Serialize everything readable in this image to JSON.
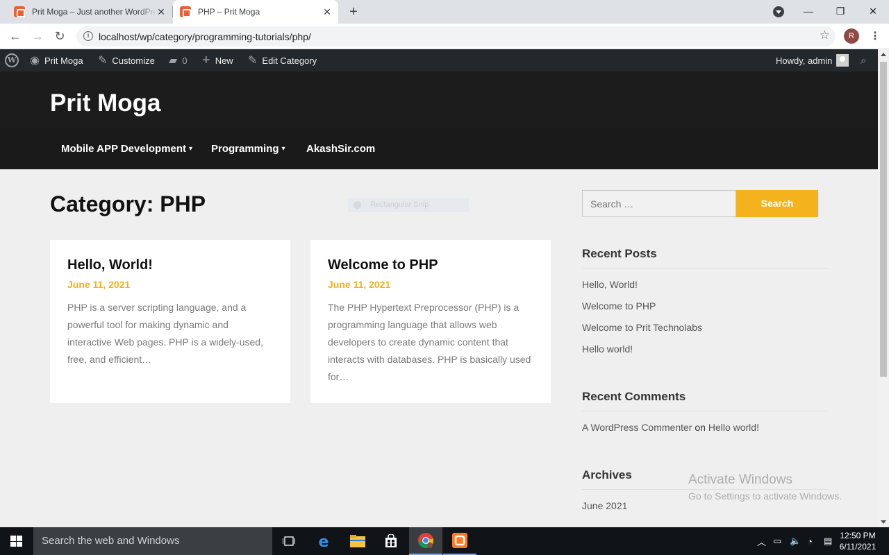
{
  "browser": {
    "tabs": [
      {
        "title": "Prit Moga – Just another WordPress site",
        "active": false
      },
      {
        "title": "PHP – Prit Moga",
        "active": true
      }
    ],
    "new_tab_label": "+",
    "url": "localhost/wp/category/programming-tutorials/php/",
    "profile_initial": "R"
  },
  "admin_bar": {
    "site_name": "Prit Moga",
    "customize": "Customize",
    "comments_count": "0",
    "new": "New",
    "edit_category": "Edit Category",
    "howdy": "Howdy, admin"
  },
  "site": {
    "title": "Prit Moga",
    "menu": [
      {
        "label": "Mobile APP Development",
        "has_submenu": true
      },
      {
        "label": "Programming",
        "has_submenu": true
      },
      {
        "label": "AkashSir.com",
        "has_submenu": false
      }
    ]
  },
  "page": {
    "title_prefix": "Category:",
    "title_value": "PHP",
    "ghost_label": "Rectangular Snip"
  },
  "posts": [
    {
      "title": "Hello, World!",
      "date": "June 11, 2021",
      "excerpt": "PHP is a server scripting language, and a powerful tool for making dynamic and interactive Web pages. PHP is a widely-used, free, and efficient…"
    },
    {
      "title": "Welcome to PHP",
      "date": "June 11, 2021",
      "excerpt": "The PHP Hypertext Preprocessor (PHP) is a programming language that allows web developers to create dynamic content that interacts with databases. PHP is basically used for…"
    }
  ],
  "sidebar": {
    "search_placeholder": "Search …",
    "search_button": "Search",
    "recent_posts_title": "Recent Posts",
    "recent_posts": [
      "Hello, World!",
      "Welcome to PHP",
      "Welcome to Prit Technolabs",
      "Hello world!"
    ],
    "recent_comments_title": "Recent Comments",
    "comment": {
      "author": "A WordPress Commenter",
      "on": "on",
      "post": "Hello world!"
    },
    "archives_title": "Archives",
    "archives": [
      "June 2021"
    ]
  },
  "watermark": {
    "line1": "Activate Windows",
    "line2": "Go to Settings to activate Windows."
  },
  "taskbar": {
    "search_placeholder": "Search the web and Windows",
    "time": "12:50 PM",
    "date": "6/11/2021"
  },
  "colors": {
    "accent": "#f4b31d",
    "header_bg": "#1c1c1c",
    "admin_bar_bg": "#23282d"
  }
}
